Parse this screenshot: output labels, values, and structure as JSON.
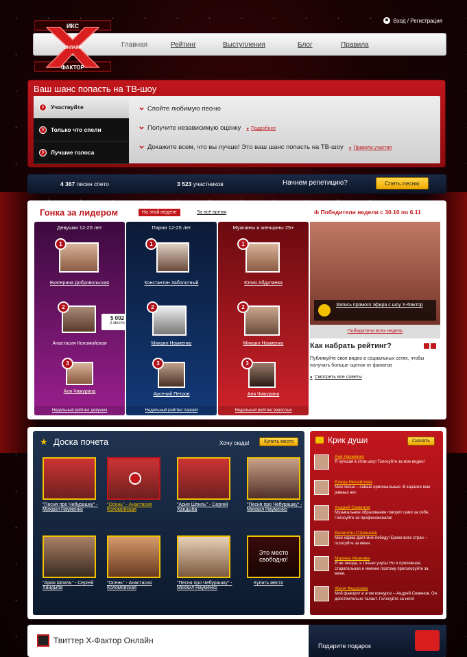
{
  "header": {
    "login_label": "Вход / Регистрация",
    "logo_top": "ИКС",
    "logo_mid": "ОНЛАЙН",
    "logo_bottom": "ФАКТОР",
    "nav": [
      "Главная",
      "Рейтинг",
      "Выступления",
      "Блог",
      "Правила"
    ]
  },
  "promo": {
    "title": "Ваш шанс попасть на ТВ-шоу",
    "menu": [
      "Участвуйте",
      "Только что спели",
      "Лучшие голоса"
    ],
    "steps": [
      "Спойте любимую песню",
      "Получите независимую оценку",
      "Докажите всем, что вы лучше! Это ваш шанс попасть на ТВ-шоу"
    ],
    "more_link": "Подробнее",
    "rules_link": "Правила участия"
  },
  "stats": {
    "songs_num": "4 367",
    "songs_label": "песен спето",
    "users_num": "3 523",
    "users_label": "участников",
    "cta_text": "Начнем репетицию?",
    "cta_button": "Спеть песню"
  },
  "race": {
    "title": "Гонка за лидером",
    "tab_week": "На этой неделе",
    "tab_all": "За всё время",
    "winners_title": "Победители недели с 30.10 по 6.11",
    "columns": [
      {
        "header": "Девушки 12-25 лет",
        "names": [
          "Екатерина Добровольская",
          "Анастасия Коломойская",
          "Аня Чижурина"
        ],
        "footer": "Недельный рейтинг девушек"
      },
      {
        "header": "Парни 12-25 лет",
        "names": [
          "Константин Заболотный",
          "Михаил Науменко",
          "Арсений Петров"
        ],
        "footer": "Недельный рейтинг парней"
      },
      {
        "header": "Мужчины и женщины 25+",
        "names": [
          "Юлия Абдулаева",
          "Михаил Науменко",
          "Аня Чижурина"
        ],
        "footer": "Недельный рейтинг взрослых"
      }
    ],
    "score_value": "5 002",
    "score_place": "2 место",
    "video_caption": "Запись прямого эфира с шоу Х-Фактор",
    "all_winners": "Победители всех недель",
    "rating_title": "Как набрать рейтинг?",
    "rating_text": "Публикуйте свое видео в социальных сетях, чтобы получать больше оценок от фанатов",
    "rating_link": "Смотреть все советы"
  },
  "board": {
    "title": "Доска почета",
    "want": "Хочу сюда!",
    "buy": "Купить место",
    "items": [
      "\"Песня про Чебурашку\" - Михаил Науменко",
      "\"Осень\" - Анастасия Коломойская",
      "\"Ария Шпиль\" - Сергей Хандыба",
      "\"Песня про Чебурашку\" - Михаил Науменко",
      "\"Ария Шпиль\" - Сергей Хандыба",
      "\"Осень\" - Анастасия Коломойская",
      "\"Песня про Чебурашку\" - Михаил Науменко"
    ],
    "free_text": "Это место свободно!",
    "free_link": "Купить место"
  },
  "krik": {
    "title": "Крик души",
    "button": "Сказать",
    "posts": [
      {
        "name": "Аня Науменко",
        "text": "Я лучшая в этом шоу! Голосуйте за мое видео!"
      },
      {
        "name": "Елена Михайлова",
        "text": "Мои песни – самые оригинальные. В караоке мне равных нет."
      },
      {
        "name": "Андрей Семенов",
        "text": "Музыкальное образование говорит само за себя. Голосуйте за профессионала!"
      },
      {
        "name": "Валентин Стрешнев",
        "text": "Мои карма дает мне победу! Ерики всех стран – голосуйте за меня."
      },
      {
        "name": "Марина Иванова",
        "text": "Я не звезда, я только учусь! Но я прилежная, старательная и именно поэтому проголосуйте за меня."
      },
      {
        "name": "Женя Федорова",
        "text": "Мой фаворит в этом конкурсе – Андрей Семенов. Он действительно талант. Голосуйте за него!"
      }
    ]
  },
  "twitter": {
    "title": "Твиттер Х-Фактор Онлайн",
    "gift": "Подарите подарок"
  }
}
